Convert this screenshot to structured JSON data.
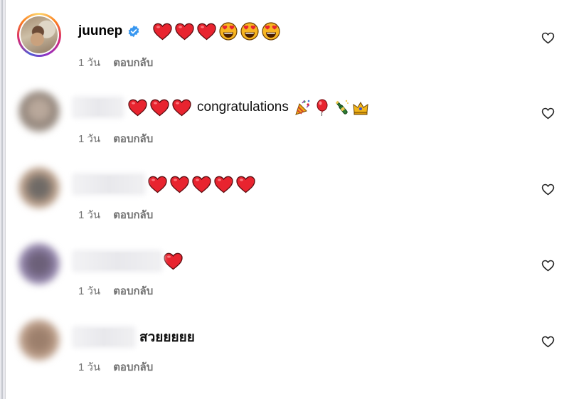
{
  "comments": [
    {
      "username": "juunep",
      "verified": true,
      "text": "",
      "hearts": 3,
      "faces": 3,
      "time": "1 วัน",
      "reply_label": "ตอบกลับ"
    },
    {
      "username": "",
      "text": "congratulations",
      "hearts": 3,
      "extra_emoji": [
        "party-popper-icon",
        "balloon-icon",
        "champagne-icon",
        "crown-icon"
      ],
      "time": "1 วัน",
      "reply_label": "ตอบกลับ"
    },
    {
      "username": "",
      "text": "",
      "hearts": 5,
      "time": "1 วัน",
      "reply_label": "ตอบกลับ"
    },
    {
      "username": "",
      "text": "",
      "hearts": 1,
      "time": "1 วัน",
      "reply_label": "ตอบกลับ"
    },
    {
      "username": "",
      "text": "สวยยยยย",
      "hearts": 0,
      "time": "1 วัน",
      "reply_label": "ตอบกลับ"
    }
  ],
  "colors": {
    "heart": "#e8242f",
    "verified": "#3897f0",
    "meta_text": "#737373"
  }
}
